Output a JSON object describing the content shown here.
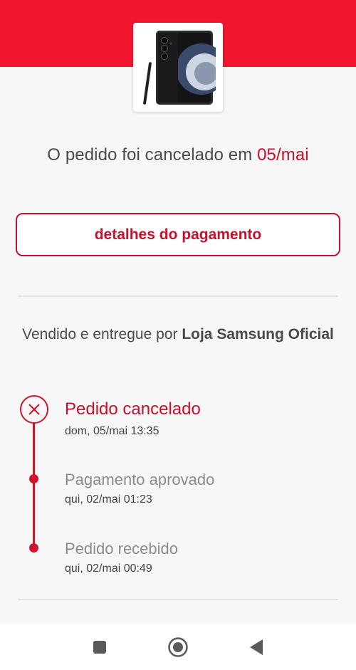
{
  "header": {
    "band_color": "#f0162e",
    "product_image_icon": "samsung-galaxy-phone-image"
  },
  "order": {
    "status_prefix": "O pedido foi cancelado em",
    "status_date": "05/mai"
  },
  "payment_button_label": "detalhes do pagamento",
  "seller": {
    "prefix": "Vendido e entregue por",
    "name": "Loja Samsung Oficial"
  },
  "timeline": [
    {
      "title": "Pedido cancelado",
      "time": "dom, 05/mai 13:35",
      "state": "cancelled"
    },
    {
      "title": "Pagamento aprovado",
      "time": "qui, 02/mai 01:23",
      "state": "done"
    },
    {
      "title": "Pedido recebido",
      "time": "qui, 02/mai 00:49",
      "state": "done"
    }
  ],
  "navigation": {
    "recents_icon": "square-icon",
    "home_icon": "circle-home-icon",
    "back_icon": "back-triangle-icon"
  },
  "colors": {
    "accent": "#c8102e",
    "timeline": "#d0142c"
  }
}
